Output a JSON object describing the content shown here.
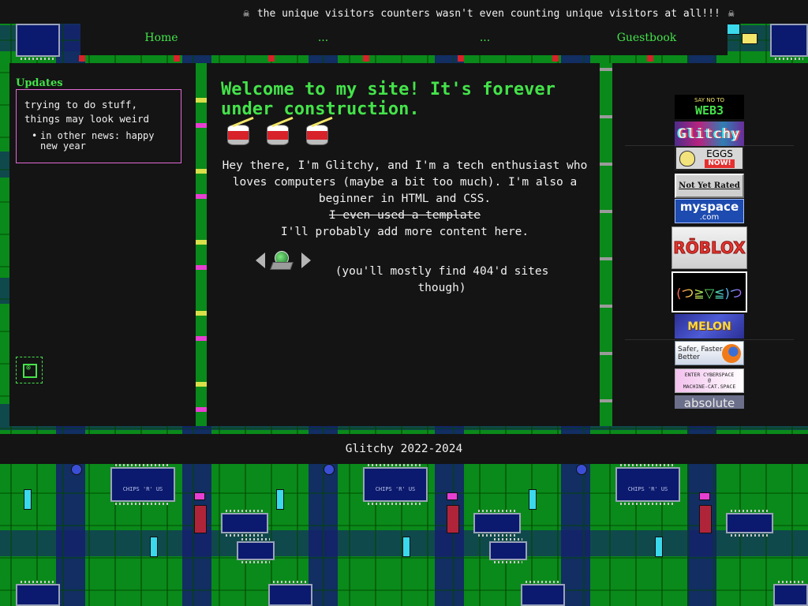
{
  "marquee": {
    "text": "the unique visitors counters wasn't even counting unique visitors at all!!!"
  },
  "nav": {
    "items": [
      "Home",
      "...",
      "...",
      "Guestbook"
    ]
  },
  "updates": {
    "title": "Updates",
    "text": "trying to do stuff, things may look weird",
    "items": [
      "in other news: happy new year"
    ]
  },
  "main": {
    "heading": "Welcome to my site! It's forever under construction.",
    "intro": "Hey there, I'm Glitchy, and I'm a tech enthusiast who loves computers (maybe a bit too much). I'm also a beginner in HTML and CSS.",
    "struck": "I even used a template",
    "more": "I'll probably add more content here.",
    "note": "(you'll mostly find 404'd sites though)"
  },
  "buttons": [
    {
      "name": "web3-button",
      "lines": [
        "SAY NO TO",
        "WEB3"
      ]
    },
    {
      "name": "glitchy-button",
      "lines": [
        "Glitchy"
      ]
    },
    {
      "name": "eggs-button",
      "lines": [
        "EGGS",
        "NOW!"
      ]
    },
    {
      "name": "not-yet-rated-button",
      "lines": [
        "Not Yet Rated"
      ]
    },
    {
      "name": "myspace-button",
      "lines": [
        "myspace",
        ".com"
      ]
    },
    {
      "name": "roblox-button",
      "lines": [
        "RŌBLOX"
      ]
    },
    {
      "name": "kaomoji-button",
      "lines": [
        "(つ≧▽≦)つ"
      ]
    },
    {
      "name": "melon-button",
      "lines": [
        "MELON"
      ]
    },
    {
      "name": "firefox-button",
      "lines": [
        "Safer, Faster,",
        "Better"
      ]
    },
    {
      "name": "cyberspace-button",
      "lines": [
        "ENTER CYBERSPACE",
        "@",
        "MACHINE-CAT.SPACE"
      ]
    },
    {
      "name": "absolute-button",
      "lines": [
        "absolute"
      ]
    }
  ],
  "footer": {
    "text": "Glitchy 2022-2024"
  },
  "decor": {
    "chip_label": "CHIPS 'R' US",
    "chip_code": "TDL-MIX TCHOC21A 0072"
  },
  "colors": {
    "accent": "#44e34a",
    "panel": "#141414",
    "pcb": "#0a8a1a",
    "border": "#e26ad5"
  }
}
